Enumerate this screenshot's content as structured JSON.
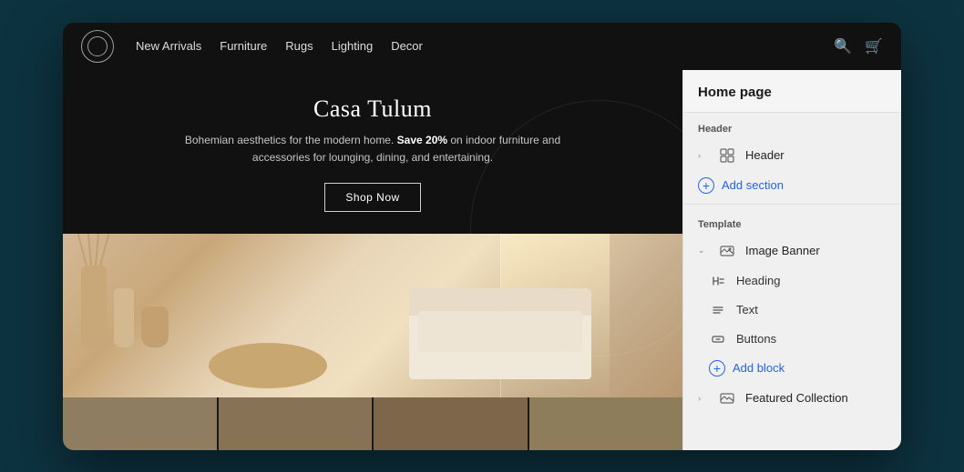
{
  "page": {
    "title": "Home page"
  },
  "nav": {
    "links": [
      "New Arrivals",
      "Furniture",
      "Rugs",
      "Lighting",
      "Decor"
    ]
  },
  "hero": {
    "title": "Casa Tulum",
    "subtitle_plain": "Bohemian aesthetics for the modern home. ",
    "subtitle_bold": "Save 20%",
    "subtitle_after": " on indoor furniture and accessories for lounging, dining, and entertaining.",
    "cta_label": "Shop Now"
  },
  "panel": {
    "title": "Home page",
    "sections": {
      "header_label": "Header",
      "template_label": "Template"
    },
    "items": {
      "header": "Header",
      "add_section": "Add section",
      "image_banner": "Image Banner",
      "heading": "Heading",
      "text": "Text",
      "buttons": "Buttons",
      "add_block": "Add block",
      "featured_collection": "Featured Collection"
    }
  }
}
